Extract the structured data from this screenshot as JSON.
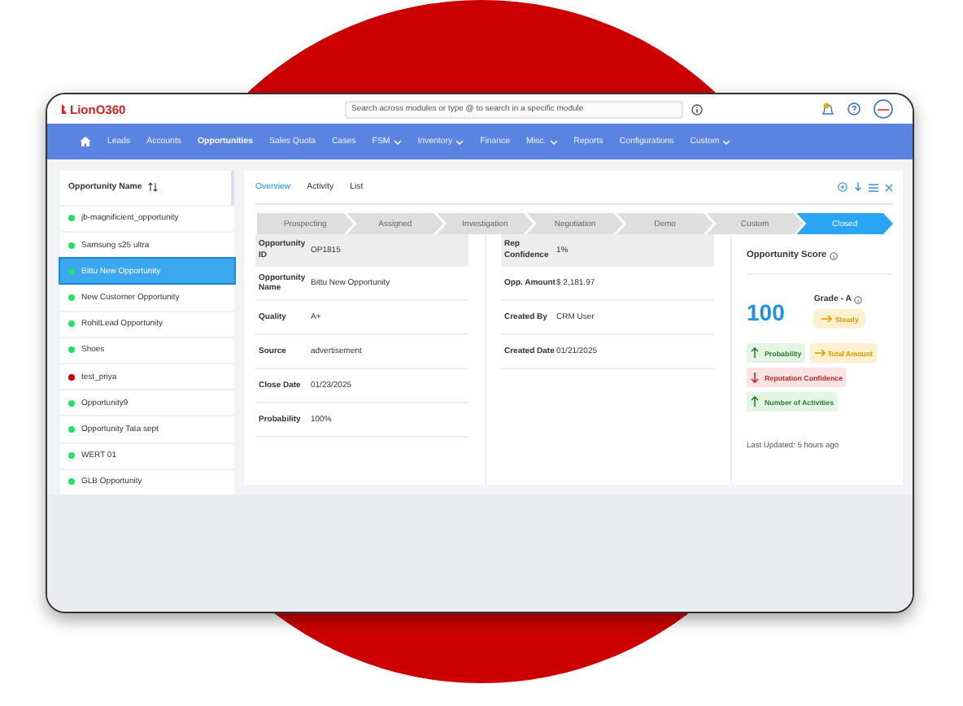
{
  "header": {
    "logo": "LionO360",
    "search": {
      "placeholder": "Search across modules or type @ to search in a specific module"
    }
  },
  "nav": [
    {
      "label": "Leads",
      "selected": false,
      "dropdown": false
    },
    {
      "label": "Accounts",
      "selected": false,
      "dropdown": false
    },
    {
      "label": "Opportunities",
      "selected": true,
      "dropdown": false
    },
    {
      "label": "Sales Quota",
      "selected": false,
      "dropdown": false
    },
    {
      "label": "Cases",
      "selected": false,
      "dropdown": false
    },
    {
      "label": "FSM",
      "selected": false,
      "dropdown": true
    },
    {
      "label": "Inventory",
      "selected": false,
      "dropdown": true
    },
    {
      "label": "Finance",
      "selected": false,
      "dropdown": false
    },
    {
      "label": "Misc.",
      "selected": false,
      "dropdown": true
    },
    {
      "label": "Reports",
      "selected": false,
      "dropdown": false
    },
    {
      "label": "Configurations",
      "selected": false,
      "dropdown": false
    },
    {
      "label": "Custom",
      "selected": false,
      "dropdown": true
    }
  ],
  "list": {
    "header": "Opportunity Name",
    "items": [
      {
        "name": "jb-magnificient_opportunity",
        "selected": false,
        "color": "#22e06a"
      },
      {
        "name": "Samsung s25 ultra",
        "selected": false,
        "color": "#22e06a"
      },
      {
        "name": "Bittu New Opportunity",
        "selected": true,
        "color": "#22e06a"
      },
      {
        "name": "New Customer Opportunity",
        "selected": false,
        "color": "#22e06a"
      },
      {
        "name": "RohitLead Opportunity",
        "selected": false,
        "color": "#22e06a"
      },
      {
        "name": "Shoes",
        "selected": false,
        "color": "#22e06a"
      },
      {
        "name": "test_priya",
        "selected": false,
        "color": "#cc0000"
      },
      {
        "name": "Opportunity9",
        "selected": false,
        "color": "#22e06a"
      },
      {
        "name": "Opportunity Tata sept",
        "selected": false,
        "color": "#22e06a"
      },
      {
        "name": "WERT 01",
        "selected": false,
        "color": "#22e06a"
      },
      {
        "name": "GLB Opportunity",
        "selected": false,
        "color": "#22e06a"
      }
    ]
  },
  "tabs": [
    {
      "label": "Overview",
      "selected": true
    },
    {
      "label": "Activity",
      "selected": false
    },
    {
      "label": "List",
      "selected": false
    }
  ],
  "stages": [
    {
      "label": "Prospecting",
      "selected": false
    },
    {
      "label": "Assigned",
      "selected": false
    },
    {
      "label": "Investigation",
      "selected": false
    },
    {
      "label": "Negotiation",
      "selected": false
    },
    {
      "label": "Demo",
      "selected": false
    },
    {
      "label": "Custom",
      "selected": false
    },
    {
      "label": "Closed",
      "selected": true
    }
  ],
  "fields_left": [
    {
      "label": "Opportunity ID",
      "value": "OP1815"
    },
    {
      "label": "Opportunity Name",
      "value": "Bittu New Opportunity"
    },
    {
      "label": "Quality",
      "value": "A+"
    },
    {
      "label": "Source",
      "value": "advertisement"
    },
    {
      "label": "Close Date",
      "value": "01/23/2025"
    },
    {
      "label": "Probability",
      "value": "100%"
    }
  ],
  "fields_right": [
    {
      "label": "Rep Confidence",
      "value": "1%"
    },
    {
      "label": "Opp. Amount",
      "value": "$ 2,181.97"
    },
    {
      "label": "Created By",
      "value": "CRM User"
    },
    {
      "label": "Created Date",
      "value": "01/21/2025"
    }
  ],
  "score": {
    "title": "Opportunity Score",
    "value": "100",
    "grade": "Grade - A",
    "trend": {
      "label": "Steady",
      "kind": "neutral"
    },
    "factors": [
      {
        "label": "Probability",
        "kind": "up"
      },
      {
        "label": "Total Amount",
        "kind": "neutral"
      },
      {
        "label": "Reputation Confidence",
        "kind": "down"
      },
      {
        "label": "Number of Activities",
        "kind": "up"
      }
    ],
    "updated": "Last Updated: 5 hours ago"
  }
}
